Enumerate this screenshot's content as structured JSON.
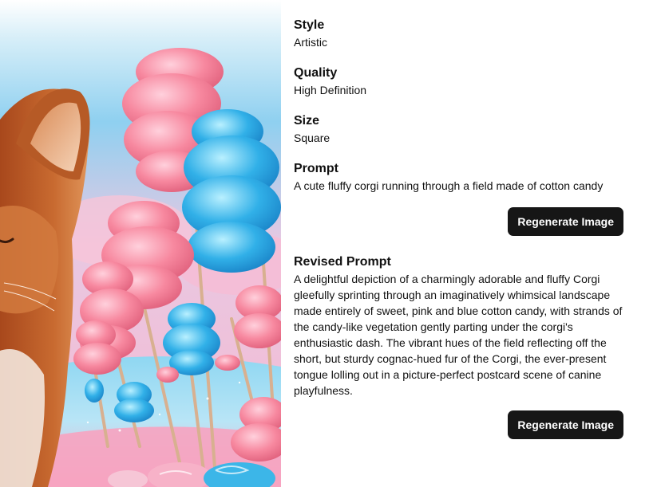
{
  "image": {
    "alt": "A cute fluffy corgi running through a field made of cotton candy",
    "colors": {
      "sky_top": "#9ed8f2",
      "sky_bottom": "#f6d3e6",
      "pink": "#f7889f",
      "blue": "#31b0e8",
      "fur": "#c4602a"
    }
  },
  "fields": {
    "style": {
      "label": "Style",
      "value": "Artistic"
    },
    "quality": {
      "label": "Quality",
      "value": "High Definition"
    },
    "size": {
      "label": "Size",
      "value": "Square"
    },
    "prompt": {
      "label": "Prompt",
      "value": "A cute fluffy corgi running through a field made of cotton candy"
    },
    "revised_prompt": {
      "label": "Revised Prompt",
      "value": "A delightful depiction of a charmingly adorable and fluffy Corgi gleefully sprinting through an imaginatively whimsical landscape made entirely of sweet, pink and blue cotton candy, with strands of the candy-like vegetation gently parting under the corgi's enthusiastic dash. The vibrant hues of the field reflecting off the short, but sturdy cognac-hued fur of the Corgi, the ever-present tongue lolling out in a picture-perfect postcard scene of canine playfulness."
    }
  },
  "actions": {
    "regenerate_label": "Regenerate Image"
  }
}
